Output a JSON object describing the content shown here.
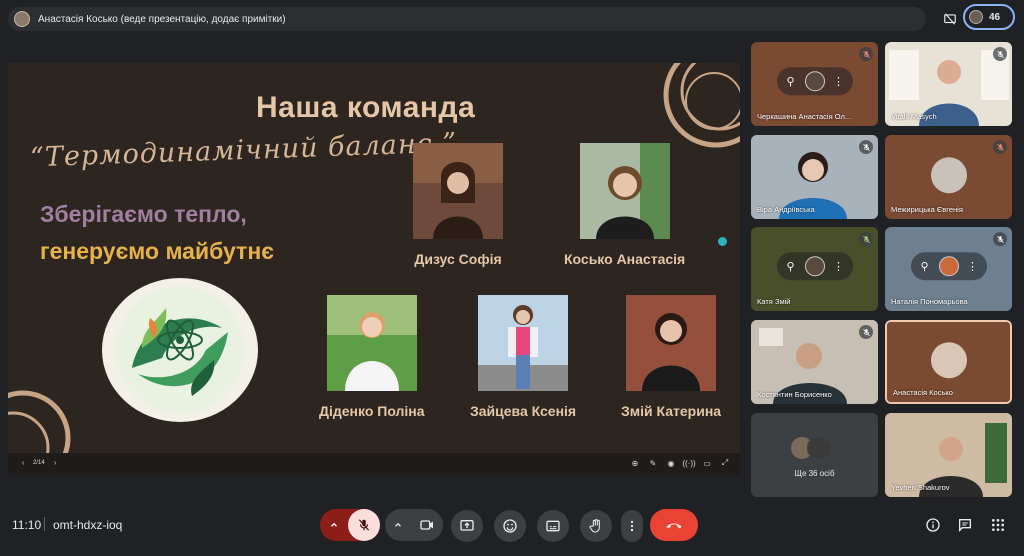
{
  "topbar": {
    "presenter_text": "Анастасія Косько (веде презентацію, додає примітки)",
    "participant_count": "46"
  },
  "slide": {
    "title": "Наша команда",
    "script_text": "“Термодинамічний баланс ”",
    "slogan_line1": "Зберігаємо тепло,",
    "slogan_line2": "генеруємо майбутнє",
    "members": [
      {
        "name": "Дизус Софія"
      },
      {
        "name": "Косько Анастасія"
      },
      {
        "name": "Діденко Поліна"
      },
      {
        "name": "Зайцева Ксенія"
      },
      {
        "name": "Змій Катерина"
      }
    ],
    "page_indicator": "2/14",
    "progress": 0.07
  },
  "tiles": [
    {
      "name": "Черкашина Анастасія Ол...",
      "bg": "#7a4a33"
    },
    {
      "name": "Vitalii Masych",
      "bg": "#e8e1d5"
    },
    {
      "name": "Віра Андріївська",
      "bg": "#9aa6b0"
    },
    {
      "name": "Межирицька Євгенія",
      "bg": "#7a4a33"
    },
    {
      "name": "Катя Змій",
      "bg": "#4a4f2b"
    },
    {
      "name": "Наталія Пономарьова",
      "bg": "#6e8090"
    },
    {
      "name": "Костянтин Борисенко",
      "bg": "#b8b0a4"
    },
    {
      "name": "Анастасія Косько",
      "bg": "#7a4a33"
    },
    {
      "name": "Ще 36 осіб",
      "bg": "#3c4043"
    },
    {
      "name": "Yevhen Shakurov",
      "bg": "#c9b7a0"
    }
  ],
  "bottom": {
    "time": "11:10",
    "meeting_code": "omt-hdxz-ioq"
  },
  "colors": {
    "accent": "#8ab4f8",
    "danger": "#ea4335",
    "slide_bg": "#2d2620",
    "title_color": "#e5c6a6"
  }
}
